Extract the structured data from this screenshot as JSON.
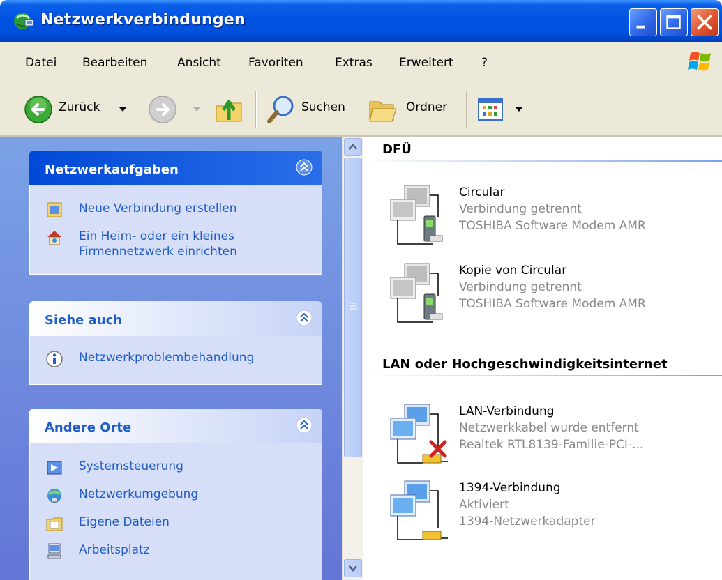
{
  "window": {
    "title": "Netzwerkverbindungen",
    "controls": [
      "minimize",
      "maximize",
      "close"
    ]
  },
  "menu": [
    {
      "label": "Datei"
    },
    {
      "label": "Bearbeiten"
    },
    {
      "label": "Ansicht"
    },
    {
      "label": "Favoriten"
    },
    {
      "label": "Extras"
    },
    {
      "label": "Erweitert"
    },
    {
      "label": "?"
    }
  ],
  "toolbar": {
    "back_label": "Zurück",
    "search_label": "Suchen",
    "folders_label": "Ordner"
  },
  "taskpane": {
    "network_tasks": {
      "title": "Netzwerkaufgaben",
      "items": [
        {
          "label": "Neue Verbindung erstellen"
        },
        {
          "label_line1": "Ein Heim- oder ein kleines",
          "label_line2": "Firmennetzwerk einrichten"
        }
      ]
    },
    "see_also": {
      "title": "Siehe auch",
      "items": [
        {
          "label": "Netzwerkproblembehandlung"
        }
      ]
    },
    "other_places": {
      "title": "Andere Orte",
      "items": [
        {
          "label": "Systemsteuerung"
        },
        {
          "label": "Netzwerkumgebung"
        },
        {
          "label": "Eigene Dateien"
        },
        {
          "label": "Arbeitsplatz"
        }
      ]
    }
  },
  "content": {
    "groups": [
      {
        "title": "DFÜ",
        "connections": [
          {
            "name": "Circular",
            "status": "Verbindung getrennt",
            "device": "TOSHIBA Software Modem AMR"
          },
          {
            "name": "Kopie von Circular",
            "status": "Verbindung getrennt",
            "device": "TOSHIBA Software Modem AMR"
          }
        ]
      },
      {
        "title": "LAN oder Hochgeschwindigkeitsinternet",
        "connections": [
          {
            "name": "LAN-Verbindung",
            "status": "Netzwerkkabel wurde entfernt",
            "device": "Realtek RTL8139-Familie-PCI-..."
          },
          {
            "name": "1394-Verbindung",
            "status": "Aktiviert",
            "device": "1394-Netzwerkadapter"
          }
        ]
      }
    ]
  },
  "colors": {
    "titlebar_blue": "#0053e1",
    "taskpane_link": "#215dc6",
    "menubar_bg": "#ece9d8",
    "taskpane_bg": "#7ba2e7",
    "panel_body_bg": "#d6dff7",
    "status_gray": "#888888"
  }
}
